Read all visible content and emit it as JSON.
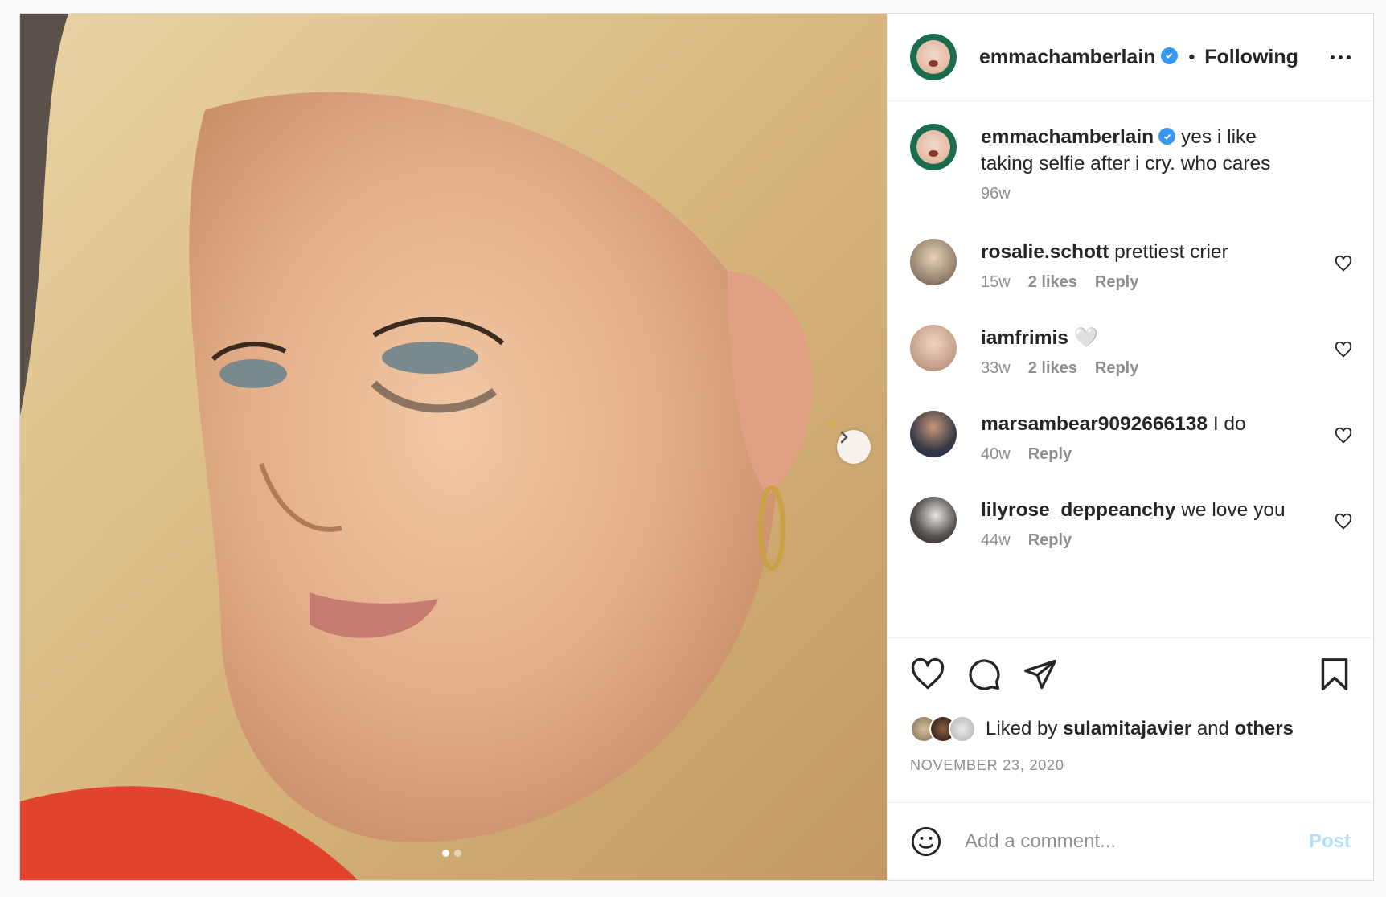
{
  "post": {
    "author": "emmachamberlain",
    "header_separator": "•",
    "follow_status": "Following",
    "caption": "yes i like taking selfie after i cry. who cares",
    "caption_age": "96w"
  },
  "comments": [
    {
      "username": "rosalie.schott",
      "text": "prettiest crier",
      "age": "15w",
      "likes": "2 likes",
      "reply": "Reply"
    },
    {
      "username": "iamfrimis",
      "text": "🤍",
      "age": "33w",
      "likes": "2 likes",
      "reply": "Reply"
    },
    {
      "username": "marsambear9092666138",
      "text": "I do",
      "age": "40w",
      "likes": "",
      "reply": "Reply"
    },
    {
      "username": "lilyrose_deppeanchy",
      "text": "we love you",
      "age": "44w",
      "likes": "",
      "reply": "Reply"
    }
  ],
  "likes": {
    "prefix": "Liked by",
    "user": "sulamitajavier",
    "and": "and",
    "others": "others"
  },
  "date": "NOVEMBER 23, 2020",
  "add_comment": {
    "placeholder": "Add a comment...",
    "post_label": "Post"
  },
  "colors": {
    "verified": "#3897f0",
    "post_button_disabled": "#b2dffc",
    "muted_text": "#8e8e8e"
  },
  "icons": {
    "header": [
      "verified-badge-icon",
      "more-options-icon"
    ],
    "actions": [
      "heart-icon",
      "comment-icon",
      "share-icon",
      "bookmark-icon"
    ],
    "carousel": [
      "chevron-right-icon"
    ],
    "composer": [
      "emoji-icon"
    ]
  }
}
